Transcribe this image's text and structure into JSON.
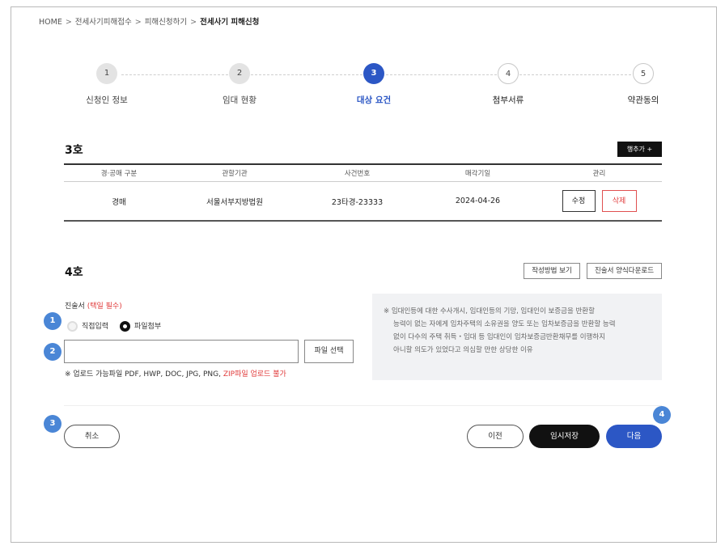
{
  "breadcrumb": {
    "home": "HOME",
    "sep": ">",
    "level1": "전세사기피해접수",
    "level2": "피해신청하기",
    "current": "전세사기 피해신청"
  },
  "stepper": {
    "steps": [
      {
        "number": "1",
        "label": "신청인 정보",
        "state": "done"
      },
      {
        "number": "2",
        "label": "임대 현황",
        "state": "done"
      },
      {
        "number": "3",
        "label": "대상 요건",
        "state": "active"
      },
      {
        "number": "4",
        "label": "첨부서류",
        "state": "todo"
      },
      {
        "number": "5",
        "label": "약관동의",
        "state": "todo"
      }
    ]
  },
  "section3": {
    "title": "3호",
    "add_row_label": "행추가 +",
    "columns": [
      "경·공매 구분",
      "관할기관",
      "사건번호",
      "매각기일",
      "관리"
    ],
    "rows": [
      {
        "type": "경매",
        "court": "서울서부지방법원",
        "case_no": "23타경-23333",
        "sale_date": "2024-04-26",
        "edit_label": "수정",
        "delete_label": "삭제"
      }
    ]
  },
  "section4": {
    "title": "4호",
    "guide_button": "작성방법 보기",
    "download_button": "진술서 양식다운로드",
    "statement_label": "진술서",
    "statement_required": "(택일 필수)",
    "radio_direct": "직접입력",
    "radio_file": "파일첨부",
    "radio_selected": "파일첨부",
    "file_input_value": "",
    "file_button": "파일 선택",
    "upload_note": "※ 업로드 가능파일 PDF, HWP, DOC, JPG, PNG,",
    "upload_warning": "ZIP파일 업로드 불가",
    "info_lines": [
      "※ 임대인등에 대한 수사개시, 임대인등의 기망, 임대인이 보증금을 반환할",
      "능력이 없는 자에게 임차주택의 소유권을 양도 또는 임차보증금을 반환할 능력",
      "없이 다수의 주택 취득・임대 등 임대인이 임차보증금반환채무를 이행하지",
      "아니할 의도가 있었다고 의심할 만한 상당한 이유"
    ]
  },
  "badges": [
    "1",
    "2",
    "3",
    "4"
  ],
  "footer": {
    "cancel": "취소",
    "prev": "이전",
    "save_draft": "임시저장",
    "next": "다음"
  },
  "colors": {
    "primary": "#2c57c5",
    "badge": "#4a86d6",
    "danger": "#e03a3a",
    "dark": "#111111"
  }
}
